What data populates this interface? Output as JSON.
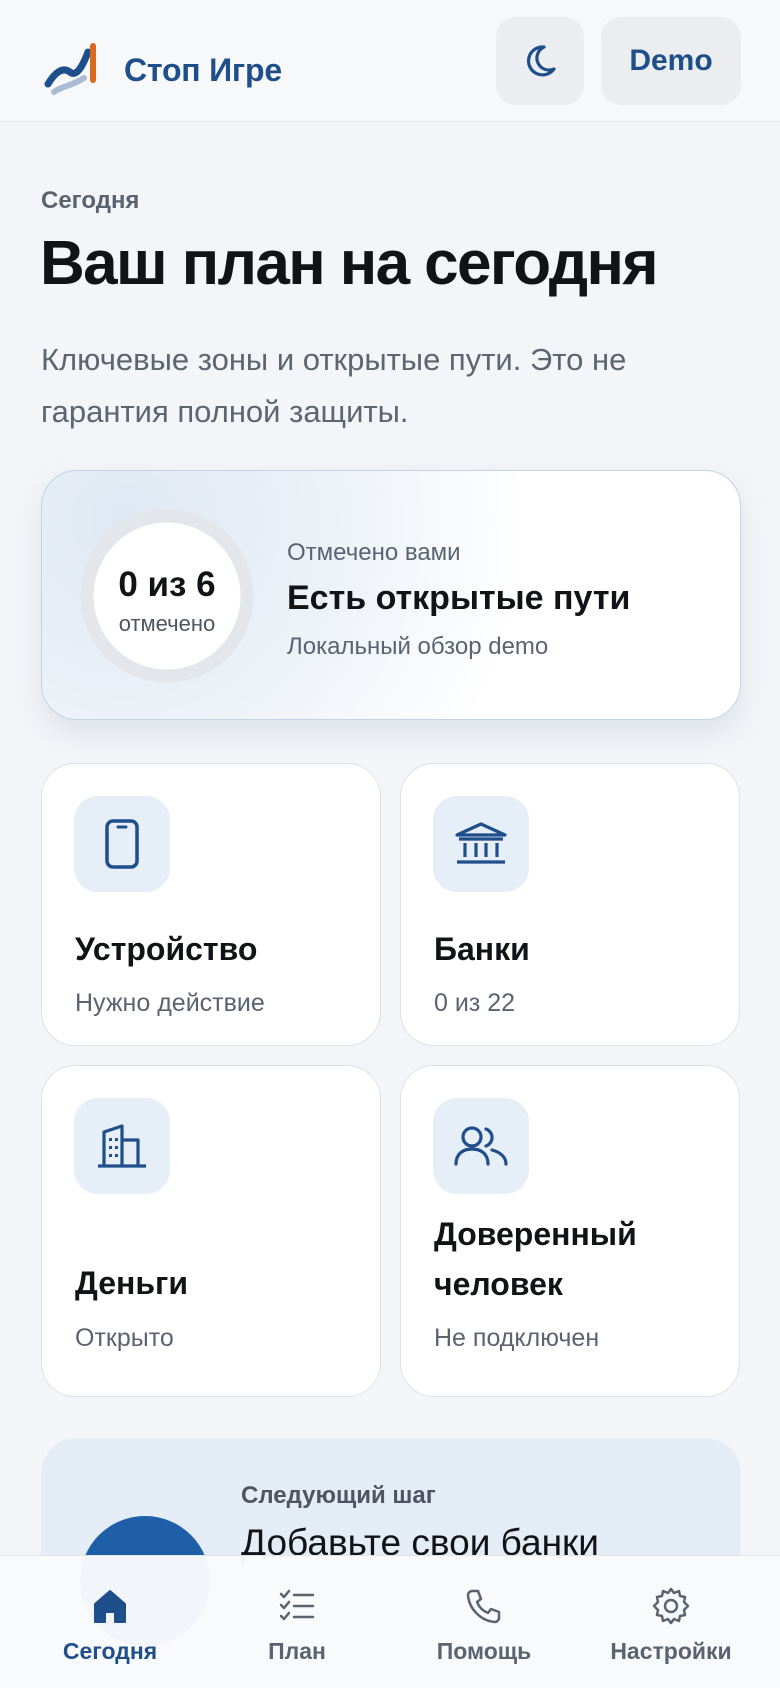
{
  "header": {
    "brand_name": "Стоп Игре",
    "theme_icon": "moon-icon",
    "demo_label": "Demo"
  },
  "intro": {
    "eyebrow": "Сегодня",
    "title": "Ваш план на сегодня",
    "subtitle": "Ключевые зоны и открытые пути. Это не гарантия полной защиты."
  },
  "progress": {
    "value": "0 из 6",
    "caption": "отмечено",
    "label": "Отмечено вами",
    "status": "Есть открытые пути",
    "note": "Локальный обзор demo",
    "checked": 0,
    "total": 6
  },
  "tiles": [
    {
      "title": "Устройство",
      "subtitle": "Нужно действие",
      "icon": "phone-icon"
    },
    {
      "title": "Банки",
      "subtitle": "0 из 22",
      "icon": "bank-icon"
    },
    {
      "title": "Деньги",
      "subtitle": "Открыто",
      "icon": "buildings-icon"
    },
    {
      "title": "Доверенный человек",
      "subtitle": "Не подключен",
      "icon": "people-icon"
    }
  ],
  "next_step": {
    "label": "Следующий шаг",
    "title": "Добавьте свои банки"
  },
  "nav": [
    {
      "label": "Сегодня",
      "icon": "home-icon",
      "active": true
    },
    {
      "label": "План",
      "icon": "checklist-icon",
      "active": false
    },
    {
      "label": "Помощь",
      "icon": "phone-call-icon",
      "active": false
    },
    {
      "label": "Настройки",
      "icon": "gear-icon",
      "active": false
    }
  ],
  "colors": {
    "accent": "#1f4f8a",
    "background": "#f3f5f8",
    "icon_tile": "#e6eef8"
  }
}
